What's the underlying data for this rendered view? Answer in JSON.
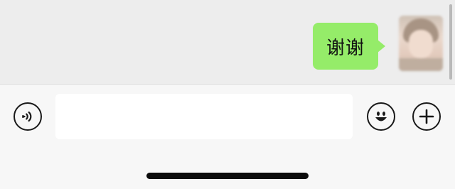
{
  "chat": {
    "messages": [
      {
        "sender": "self",
        "text": "谢谢"
      }
    ]
  },
  "input_bar": {
    "text_value": "",
    "placeholder": "",
    "icons": {
      "voice": "voice-icon",
      "emoji": "emoji-icon",
      "more": "plus-icon"
    }
  },
  "colors": {
    "bubble": "#95ec69",
    "chat_background": "#ededed",
    "input_bar_background": "#f7f7f7",
    "icon": "#191919"
  }
}
